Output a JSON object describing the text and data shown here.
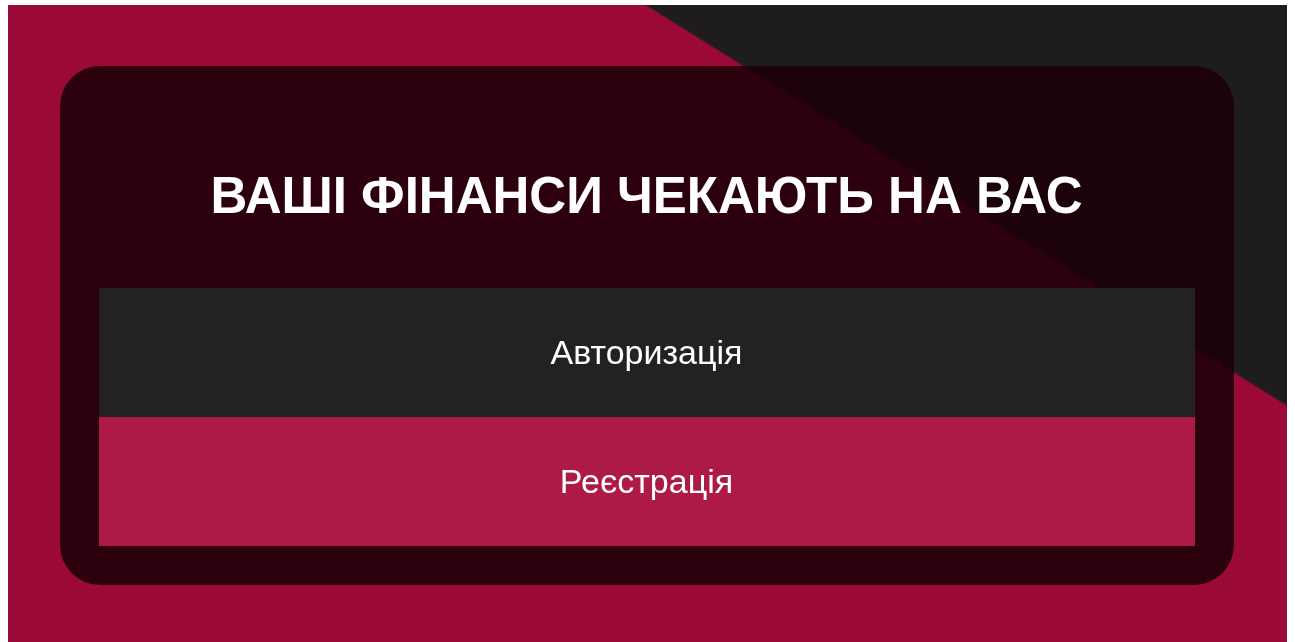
{
  "title": "ВАШІ ФІНАНСИ ЧЕКАЮТЬ НА ВАС",
  "buttons": [
    {
      "label": "Авторизація",
      "kind": "dark"
    },
    {
      "label": "Реєстрація",
      "kind": "accent"
    }
  ]
}
